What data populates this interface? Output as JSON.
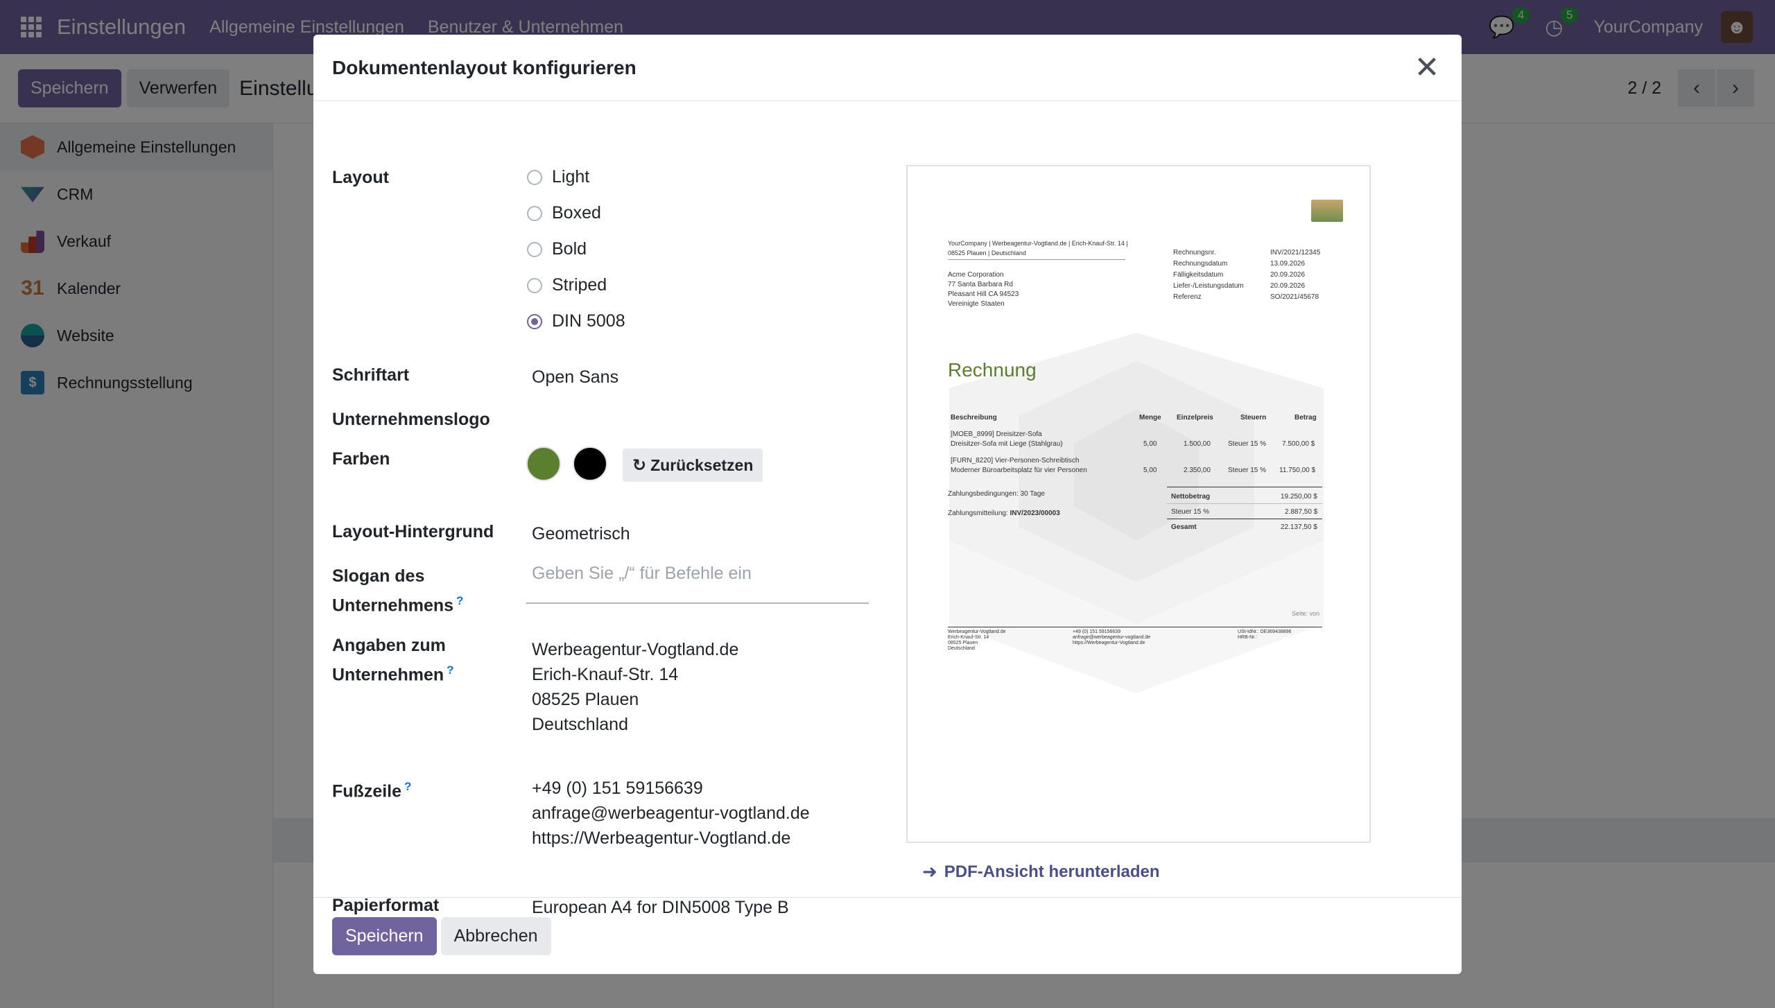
{
  "topbar": {
    "app_title": "Einstellungen",
    "menu": [
      "Allgemeine Einstellungen",
      "Benutzer & Unternehmen"
    ],
    "messages_count": "4",
    "activities_count": "5",
    "company": "YourCompany"
  },
  "controlbar": {
    "save_label": "Speichern",
    "discard_label": "Verwerfen",
    "title": "Einstellu",
    "pager": "2 / 2"
  },
  "sidebar": {
    "items": [
      {
        "label": "Allgemeine Einstellungen"
      },
      {
        "label": "CRM"
      },
      {
        "label": "Verkauf"
      },
      {
        "label": "Kalender",
        "icon_text": "31"
      },
      {
        "label": "Website"
      },
      {
        "label": "Rechnungsstellung",
        "icon_text": "$"
      }
    ]
  },
  "modal": {
    "title": "Dokumentenlayout konfigurieren",
    "layout_label": "Layout",
    "layout_options": [
      "Light",
      "Boxed",
      "Bold",
      "Striped",
      "DIN 5008"
    ],
    "layout_selected": "DIN 5008",
    "font_label": "Schriftart",
    "font_value": "Open Sans",
    "logo_label": "Unternehmenslogo",
    "colors_label": "Farben",
    "color_primary": "#5b7f2e",
    "color_secondary": "#000000",
    "reset_label": "Zurücksetzen",
    "background_label": "Layout-Hintergrund",
    "background_value": "Geometrisch",
    "slogan_label_1": "Slogan des",
    "slogan_label_2": "Unternehmens",
    "slogan_placeholder": "Geben Sie „/“ für Befehle ein",
    "details_label_1": "Angaben zum",
    "details_label_2": "Unternehmen",
    "details_lines": [
      "Werbeagentur-Vogtland.de",
      "Erich-Knauf-Str. 14",
      "08525 Plauen",
      "Deutschland"
    ],
    "footer_label": "Fußzeile",
    "footer_lines": [
      "+49 (0) 151 59156639",
      "anfrage@werbeagentur-vogtland.de",
      "https://Werbeagentur-Vogtland.de"
    ],
    "paper_label": "Papierformat",
    "paper_value": "European A4 for DIN5008 Type B",
    "help_mark": "?",
    "pdf_link": "PDF-Ansicht herunterladen",
    "save_label": "Speichern",
    "cancel_label": "Abbrechen"
  },
  "preview": {
    "sender": "YourCompany | Werbeagentur-Vogtland.de | Erich-Knauf-Str. 14 |",
    "sender2": "08525 Plauen | Deutschland",
    "recipient": [
      "Acme Corporation",
      "77 Santa Barbara Rd",
      "Pleasant Hill CA 94523",
      "Vereinigte Staaten"
    ],
    "info_labels": [
      "Rechnungsnr.",
      "Rechnungsdatum",
      "Fälligkeitsdatum",
      "Liefer-/Leistungsdatum",
      "Referenz"
    ],
    "info_values": [
      "INV/2021/12345",
      "13.09.2026",
      "20.09.2026",
      "20.09.2026",
      "SO/2021/45678"
    ],
    "heading": "Rechnung",
    "col_headers": [
      "Beschreibung",
      "Menge",
      "Einzelpreis",
      "Steuern",
      "Betrag"
    ],
    "rows": [
      {
        "d1": "[MOEB_8999] Dreisitzer-Sofa",
        "d2": "Dreisitzer-Sofa mit Liege (Stahlgrau)",
        "qty": "5,00",
        "price": "1.500,00",
        "tax": "Steuer 15 %",
        "amount": "7.500,00 $"
      },
      {
        "d1": "[FURN_8220] Vier-Personen-Schreibtisch",
        "d2": "Moderner Büroarbeitsplatz für vier Personen",
        "qty": "5,00",
        "price": "2.350,00",
        "tax": "Steuer 15 %",
        "amount": "11.750,00 $"
      }
    ],
    "payment_terms": "Zahlungsbedingungen: 30 Tage",
    "payment_ref_label": "Zahlungsmitteilung:",
    "payment_ref": "INV/2023/00003",
    "net_label": "Nettobetrag",
    "net_value": "19.250,00 $",
    "tax_label": "Steuer 15 %",
    "tax_value": "2.887,50 $",
    "total_label": "Gesamt",
    "total_value": "22.137,50 $",
    "page_label": "Seite: von",
    "foot_col1": [
      "Werbeagentur-Vogtland.de",
      "Erich-Knauf-Str. 14",
      "08525 Plauen",
      "Deutschland"
    ],
    "foot_col2": [
      "+49 (0) 151 59156639",
      "anfrage@werbeagentur-vogtland.de",
      "https://Werbeagentur-Vogtland.de"
    ],
    "foot_col3": [
      "USt-IdNr.: DE369438896",
      "HRB-Nr.:"
    ]
  }
}
